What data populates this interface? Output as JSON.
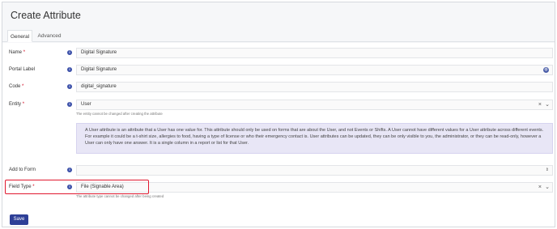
{
  "page": {
    "title": "Create Attribute"
  },
  "tabs": [
    {
      "label": "General"
    },
    {
      "label": "Advanced"
    }
  ],
  "fields": {
    "name": {
      "label": "Name",
      "required": "*",
      "value": "Digital Signature"
    },
    "portal_label": {
      "label": "Portal Label",
      "value": "Digital Signature"
    },
    "code": {
      "label": "Code",
      "required": "*",
      "value": "digital_signature"
    },
    "entity": {
      "label": "Entity",
      "required": "*",
      "value": "User",
      "hint": "The entity cannot be changed after creating the attribute"
    },
    "add_to_form": {
      "label": "Add to Form",
      "value": ""
    },
    "field_type": {
      "label": "Field Type",
      "required": "*",
      "value": "File (Signable Area)",
      "hint": "The attribute type cannot be changed after being created"
    }
  },
  "notice": {
    "text": "A User attribute is an attribute that a User has one value for. This attribute should only be used on forms that are about the User, and not Events or Shifts. A User cannot have different values for a User attribute across different events. For example it could be a t-shirt size, allergies to food, having a type of license or who their emergency contact is. User attributes can be updated, they can be only visible to you, the administrator, or they can be read-only, however a User can only have one answer. It is a single column in a report or list for that User."
  },
  "buttons": {
    "save": "Save"
  },
  "icons": {
    "info": "i",
    "clear": "×",
    "chevron": "⌄",
    "updown": "⇕",
    "globe": "◍"
  },
  "colors": {
    "accent": "#2e3f97",
    "highlight": "#e0192f",
    "required": "#d0021b",
    "notice_bg": "#e8e6f6"
  }
}
